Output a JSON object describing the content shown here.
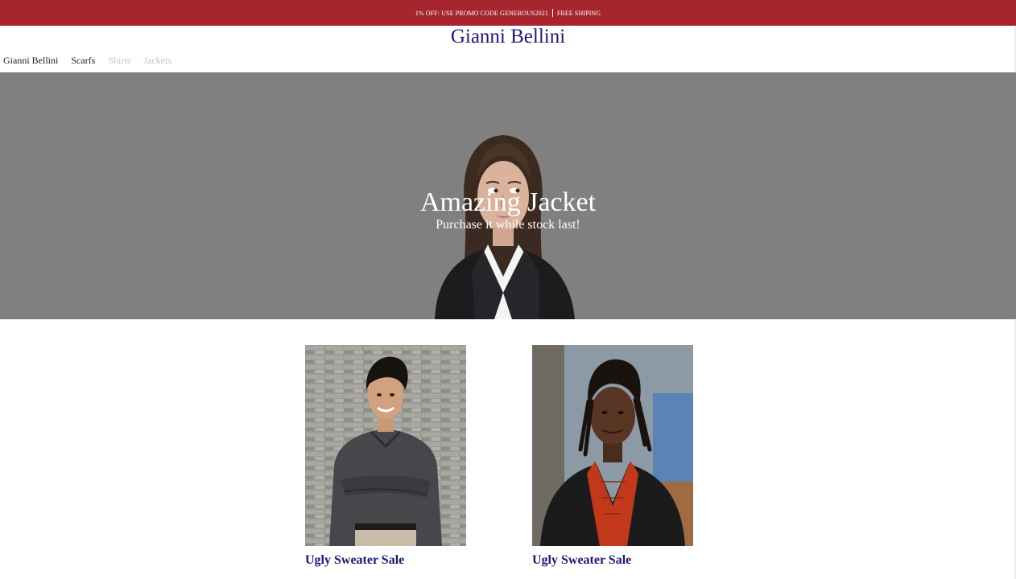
{
  "promo": {
    "offer": "1% OFF: USE PROMO CODE GENEROUS2021",
    "shipping": "FREE SHIPING",
    "background_color": "#a5262c"
  },
  "header": {
    "title": "Gianni Bellini",
    "title_color": "#1f1777"
  },
  "nav": {
    "items": [
      {
        "label": "Gianni Bellini",
        "state": "active"
      },
      {
        "label": "Scarfs",
        "state": "active"
      },
      {
        "label": "Shirts",
        "state": "disabled"
      },
      {
        "label": "Jackets",
        "state": "disabled"
      }
    ]
  },
  "hero": {
    "title": "Amazing Jacket",
    "subtitle": "Purchase it while stock last!",
    "background_color": "#808080"
  },
  "products": [
    {
      "title": "Ugly Sweater Sale",
      "photo": "man-grey-shirt-brick-wall-photo"
    },
    {
      "title": "Ugly Sweater Sale",
      "photo": "man-dark-blazer-red-shirt-photo"
    }
  ]
}
